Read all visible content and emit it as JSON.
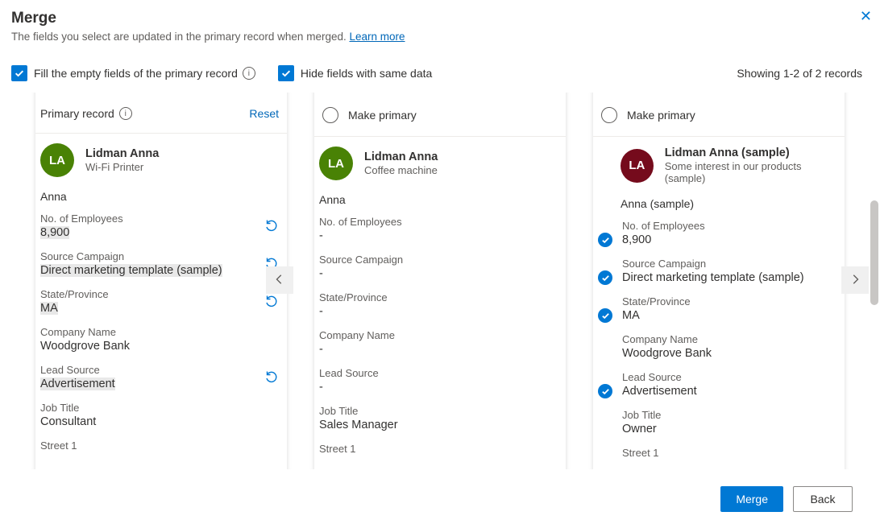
{
  "header": {
    "title": "Merge",
    "subtitle_prefix": "The fields you select are updated in the primary record when merged. ",
    "learn_more": "Learn more"
  },
  "options": {
    "fill_empty": "Fill the empty fields of the primary record",
    "hide_same": "Hide fields with same data",
    "showing": "Showing 1-2 of 2 records"
  },
  "columns": {
    "primary_label": "Primary record",
    "reset": "Reset",
    "make_primary": "Make primary"
  },
  "records": [
    {
      "initials": "LA",
      "avatar_color": "green",
      "name": "Lidman Anna",
      "sub": "Wi-Fi Printer",
      "first_name": "Anna",
      "fields": [
        {
          "label": "No. of Employees",
          "value": "8,900",
          "undo": true,
          "hl": true
        },
        {
          "label": "Source Campaign",
          "value": "Direct marketing template (sample)",
          "undo": true,
          "hl": true
        },
        {
          "label": "State/Province",
          "value": "MA",
          "undo": true,
          "hl": true
        },
        {
          "label": "Company Name",
          "value": "Woodgrove Bank"
        },
        {
          "label": "Lead Source",
          "value": "Advertisement",
          "undo": true,
          "hl": true
        },
        {
          "label": "Job Title",
          "value": "Consultant"
        },
        {
          "label": "Street 1",
          "value": ""
        }
      ]
    },
    {
      "initials": "LA",
      "avatar_color": "green",
      "name": "Lidman Anna",
      "sub": "Coffee machine",
      "first_name": "Anna",
      "fields": [
        {
          "label": "No. of Employees",
          "value": "-"
        },
        {
          "label": "Source Campaign",
          "value": "-"
        },
        {
          "label": "State/Province",
          "value": "-"
        },
        {
          "label": "Company Name",
          "value": "-"
        },
        {
          "label": "Lead Source",
          "value": "-"
        },
        {
          "label": "Job Title",
          "value": "Sales Manager"
        },
        {
          "label": "Street 1",
          "value": ""
        }
      ]
    },
    {
      "initials": "LA",
      "avatar_color": "maroon",
      "name": "Lidman Anna (sample)",
      "sub": "Some interest in our products (sample)",
      "first_name": "Anna (sample)",
      "fields": [
        {
          "label": "No. of Employees",
          "value": "8,900",
          "checked": true
        },
        {
          "label": "Source Campaign",
          "value": "Direct marketing template (sample)",
          "checked": true
        },
        {
          "label": "State/Province",
          "value": "MA",
          "checked": true
        },
        {
          "label": "Company Name",
          "value": "Woodgrove Bank"
        },
        {
          "label": "Lead Source",
          "value": "Advertisement",
          "checked": true
        },
        {
          "label": "Job Title",
          "value": "Owner"
        },
        {
          "label": "Street 1",
          "value": ""
        }
      ]
    }
  ],
  "footer": {
    "merge": "Merge",
    "back": "Back"
  }
}
